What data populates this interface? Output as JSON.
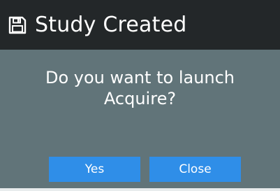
{
  "dialog": {
    "title": "Study Created",
    "title_icon": "floppy-disk-icon",
    "message_line1": "Do you want to launch",
    "message_line2": "Acquire?",
    "buttons": {
      "yes_label": "Yes",
      "close_label": "Close"
    }
  },
  "colors": {
    "titlebar_bg": "#232729",
    "body_bg": "#617479",
    "button_bg": "#2f8ee8",
    "text": "#ffffff"
  }
}
